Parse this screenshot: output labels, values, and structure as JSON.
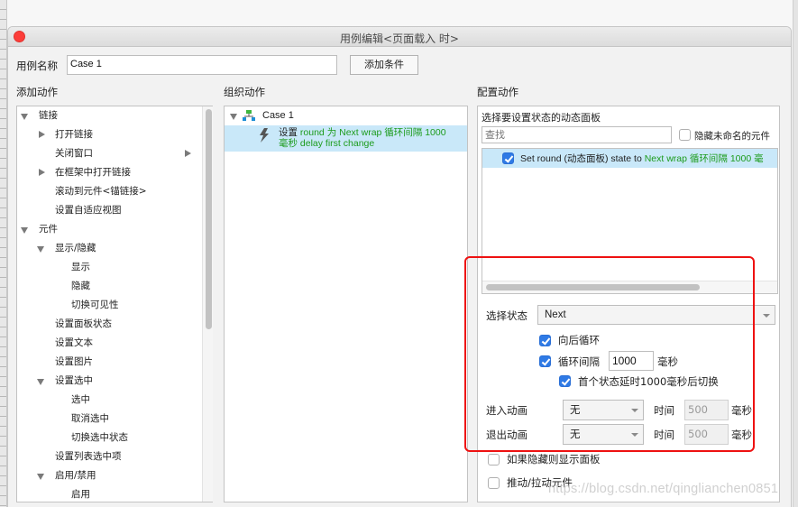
{
  "window": {
    "title": "用例编辑<页面载入 时>"
  },
  "case_name": {
    "label": "用例名称",
    "value": "Case 1",
    "add_condition_button": "添加条件"
  },
  "add_actions": {
    "heading": "添加动作",
    "tree": [
      {
        "label": "链接",
        "level": 0,
        "toggle": "expanded"
      },
      {
        "label": "打开链接",
        "level": 1,
        "toggle": "collapsed"
      },
      {
        "label": "关闭窗口",
        "level": 1,
        "toggle": "none",
        "submenu": true
      },
      {
        "label": "在框架中打开链接",
        "level": 1,
        "toggle": "collapsed"
      },
      {
        "label": "滚动到元件<锚链接>",
        "level": 1,
        "toggle": "none"
      },
      {
        "label": "设置自适应视图",
        "level": 1,
        "toggle": "none"
      },
      {
        "label": "元件",
        "level": 0,
        "toggle": "expanded"
      },
      {
        "label": "显示/隐藏",
        "level": 1,
        "toggle": "expanded"
      },
      {
        "label": "显示",
        "level": 2,
        "toggle": "none"
      },
      {
        "label": "隐藏",
        "level": 2,
        "toggle": "none"
      },
      {
        "label": "切换可见性",
        "level": 2,
        "toggle": "none"
      },
      {
        "label": "设置面板状态",
        "level": 1,
        "toggle": "none"
      },
      {
        "label": "设置文本",
        "level": 1,
        "toggle": "none"
      },
      {
        "label": "设置图片",
        "level": 1,
        "toggle": "none"
      },
      {
        "label": "设置选中",
        "level": 1,
        "toggle": "expanded"
      },
      {
        "label": "选中",
        "level": 2,
        "toggle": "none"
      },
      {
        "label": "取消选中",
        "level": 2,
        "toggle": "none"
      },
      {
        "label": "切换选中状态",
        "level": 2,
        "toggle": "none"
      },
      {
        "label": "设置列表选中项",
        "level": 1,
        "toggle": "none"
      },
      {
        "label": "启用/禁用",
        "level": 1,
        "toggle": "expanded"
      },
      {
        "label": "启用",
        "level": 2,
        "toggle": "none"
      }
    ]
  },
  "organize_actions": {
    "heading": "组织动作",
    "case_label": "Case 1",
    "action": {
      "prefix": "设置",
      "detail_line1": "round 为 Next wrap 循环间隔 1000",
      "detail_line2": "毫秒 delay first change"
    }
  },
  "configure_actions": {
    "heading": "配置动作",
    "panel_heading": "选择要设置状态的动态面板",
    "search_placeholder": "查找",
    "hide_unnamed_label": "隐藏未命名的元件",
    "hide_unnamed_checked": false,
    "panel_rows": [
      {
        "checked": true,
        "text": "Set round (动态面板) state to ",
        "green_text": "Next wrap 循环间隔 1000 毫"
      }
    ],
    "select_state_label": "选择状态",
    "select_state_value": "Next",
    "wrap_label": "向后循环",
    "wrap_checked": true,
    "loop_interval_label": "循环间隔",
    "loop_interval_value": "1000",
    "loop_interval_unit": "毫秒",
    "loop_interval_checked": true,
    "first_delay_label": "首个状态延时1000毫秒后切换",
    "first_delay_checked": true,
    "enter_anim_label": "进入动画",
    "enter_anim_value": "无",
    "enter_time_label": "时间",
    "enter_time_value": "500",
    "enter_time_unit": "毫秒",
    "exit_anim_label": "退出动画",
    "exit_anim_value": "无",
    "exit_time_label": "时间",
    "exit_time_value": "500",
    "exit_time_unit": "毫秒",
    "show_if_hidden_label": "如果隐藏则显示面板",
    "show_if_hidden_checked": false,
    "push_pull_label": "推动/拉动元件",
    "push_pull_checked": false
  },
  "watermark": "https://blog.csdn.net/qinglianchen0851",
  "colors": {
    "highlight_box": "#ee1111",
    "selection": "#c9e8f9",
    "green_text": "#1c9b1c",
    "checkbox_blue": "#2f7ae5"
  }
}
